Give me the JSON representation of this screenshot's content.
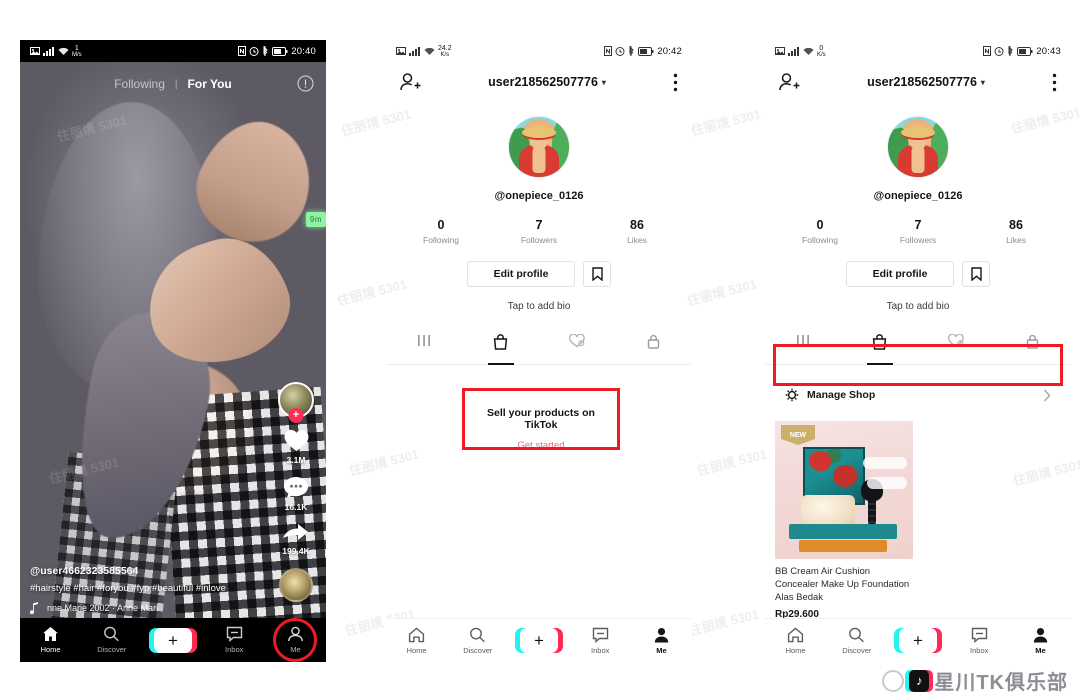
{
  "page": {
    "watermark_repeat": "住丽境 5301",
    "bottom_watermark": "星川TK俱乐部"
  },
  "phone1": {
    "statusbar": {
      "speed_num": "1",
      "speed_unit": "M/s",
      "time": "20:40"
    },
    "feed": {
      "tab_following": "Following",
      "tab_separator": "|",
      "tab_foryou": "For You",
      "green_badge": "9m",
      "likes": "3.1M",
      "comments": "16.1K",
      "shares": "199.4K",
      "caption_user": "@user4662323585564",
      "caption_tags": "#hairstyle #hair #foryou #fyp #beautiful #inlove",
      "caption_music": "nne Marie    2002 · Anne Mari"
    },
    "tabbar": [
      {
        "label": "Home",
        "icon": "home-icon",
        "active": true
      },
      {
        "label": "Discover",
        "icon": "search-icon",
        "active": false
      },
      {
        "label": "",
        "icon": "create-plus-icon",
        "active": false
      },
      {
        "label": "Inbox",
        "icon": "inbox-icon",
        "active": false
      },
      {
        "label": "Me",
        "icon": "person-icon",
        "active": false
      }
    ],
    "highlight_color": "#ee1b24"
  },
  "phone2": {
    "statusbar": {
      "speed_num": "24.2",
      "speed_unit": "K/s",
      "time": "20:42"
    },
    "header": {
      "title": "user218562507776",
      "add_friend_icon": "add-person-icon",
      "menu_icon": "more-vertical-icon"
    },
    "profile": {
      "handle": "@onepiece_0126",
      "stats": [
        {
          "value": "0",
          "label": "Following"
        },
        {
          "value": "7",
          "label": "Followers"
        },
        {
          "value": "86",
          "label": "Likes"
        }
      ],
      "edit_profile": "Edit profile",
      "bookmark_icon": "bookmark-icon",
      "bio": "Tap to add bio"
    },
    "tabs": [
      {
        "icon": "grid-posts-icon",
        "active": false
      },
      {
        "icon": "shopping-bag-icon",
        "active": true
      },
      {
        "icon": "heart-liked-icon",
        "active": false
      },
      {
        "icon": "lock-private-icon",
        "active": false
      }
    ],
    "sell_card": {
      "title": "Sell your products on TikTok",
      "action": "Get started",
      "accent": "#f2667e",
      "box_color": "#ed1c24"
    },
    "nav": [
      {
        "label": "Home",
        "icon": "home-icon",
        "active": false
      },
      {
        "label": "Discover",
        "icon": "search-icon",
        "active": false
      },
      {
        "label": "",
        "icon": "create-plus-icon",
        "active": false
      },
      {
        "label": "Inbox",
        "icon": "inbox-icon",
        "active": false
      },
      {
        "label": "Me",
        "icon": "person-icon",
        "active": true
      }
    ]
  },
  "phone3": {
    "statusbar": {
      "speed_num": "0",
      "speed_unit": "K/s",
      "time": "20:43"
    },
    "header": {
      "title": "user218562507776",
      "add_friend_icon": "add-person-icon",
      "menu_icon": "more-vertical-icon"
    },
    "profile": {
      "handle": "@onepiece_0126",
      "stats": [
        {
          "value": "0",
          "label": "Following"
        },
        {
          "value": "7",
          "label": "Followers"
        },
        {
          "value": "86",
          "label": "Likes"
        }
      ],
      "edit_profile": "Edit profile",
      "bookmark_icon": "bookmark-icon",
      "bio": "Tap to add bio"
    },
    "tabs": [
      {
        "icon": "grid-posts-icon",
        "active": false
      },
      {
        "icon": "shopping-bag-icon",
        "active": true
      },
      {
        "icon": "heart-liked-icon",
        "active": false
      },
      {
        "icon": "lock-private-icon",
        "active": false
      }
    ],
    "manage_shop": {
      "label": "Manage Shop",
      "icon": "gear-icon",
      "chevron": "chevron-right-icon",
      "box_color": "#ed1c24"
    },
    "product": {
      "badge": "NEW",
      "name": "BB Cream Air Cushion Concealer Make Up Foundation Alas Bedak",
      "price": "Rp29.600"
    },
    "nav": [
      {
        "label": "Home",
        "icon": "home-icon",
        "active": false
      },
      {
        "label": "Discover",
        "icon": "search-icon",
        "active": false
      },
      {
        "label": "",
        "icon": "create-plus-icon",
        "active": false
      },
      {
        "label": "Inbox",
        "icon": "inbox-icon",
        "active": false
      },
      {
        "label": "Me",
        "icon": "person-icon",
        "active": true
      }
    ]
  }
}
